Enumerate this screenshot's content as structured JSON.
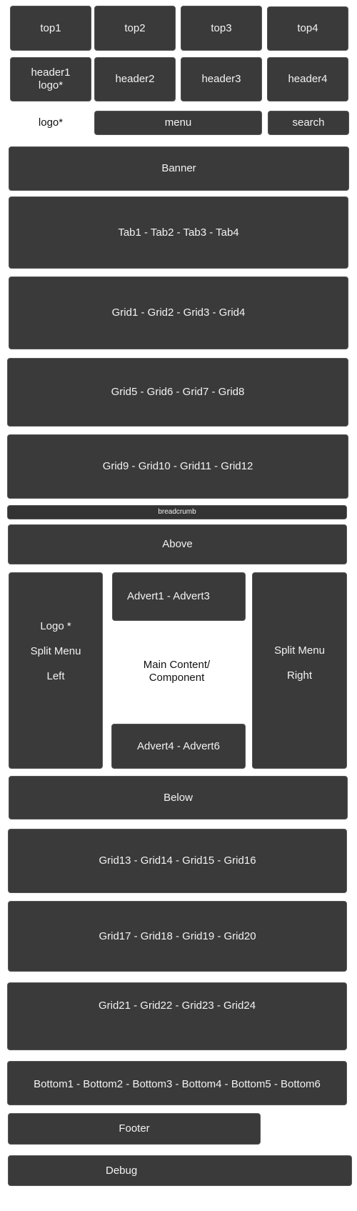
{
  "top": [
    "top1",
    "top2",
    "top3",
    "top4"
  ],
  "header": [
    "header1\nlogo*",
    "header2",
    "header3",
    "header4"
  ],
  "header1_lines": [
    "header1",
    "logo*"
  ],
  "nav": {
    "logo": "logo*",
    "menu": "menu",
    "search": "search"
  },
  "banner": "Banner",
  "tabs": "Tab1 - Tab2 - Tab3 - Tab4",
  "grids": [
    "Grid1 - Grid2 - Grid3 - Grid4",
    "Grid5 - Grid6 - Grid7 - Grid8",
    "Grid9 - Grid10 - Grid11 - Grid12"
  ],
  "breadcrumb": "breadcrumb",
  "above": "Above",
  "left_column": {
    "lines": [
      "Logo *",
      "Split Menu",
      "Left"
    ]
  },
  "adverts": {
    "top": "Advert1 - Advert3",
    "bottom": "Advert4 - Advert6"
  },
  "main_content": {
    "lines": [
      "Main Content/",
      "Component"
    ]
  },
  "right_column": {
    "lines": [
      "Split Menu",
      "Right"
    ]
  },
  "below": "Below",
  "lower_grids": [
    "Grid13 - Grid14 - Grid15 - Grid16",
    "Grid17 - Grid18 - Grid19 - Grid20",
    "Grid21 - Grid22 - Grid23 - Grid24"
  ],
  "bottom": "Bottom1 - Bottom2 - Bottom3 - Bottom4 - Bottom5 - Bottom6",
  "footer": "Footer",
  "debug": "Debug"
}
